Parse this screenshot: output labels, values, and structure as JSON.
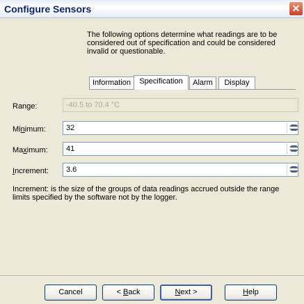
{
  "window": {
    "title": "Configure Sensors",
    "close_glyph": "✕"
  },
  "intro_text": "The following options determine what readings are to be considered out of specification and could be considered invalid or questionable.",
  "tabs": [
    {
      "label": "Information",
      "active": false
    },
    {
      "label": "Specification",
      "active": true
    },
    {
      "label": "Alarm",
      "active": false
    },
    {
      "label": "Display",
      "active": false
    }
  ],
  "fields": {
    "range": {
      "label": "Range:",
      "value": "-40.5 to 70.4 °C"
    },
    "minimum": {
      "label_pre": "Mi",
      "label_u": "n",
      "label_post": "imum:",
      "value": "32"
    },
    "maximum": {
      "label_pre": "Ma",
      "label_u": "x",
      "label_post": "imum:",
      "value": "41"
    },
    "increment": {
      "label_pre": "",
      "label_u": "I",
      "label_post": "ncrement:",
      "value": "3.6"
    }
  },
  "note": "Increment: is the size of the groups of data readings accrued outside the range limits specified by the software not by the logger.",
  "buttons": {
    "cancel": "Cancel",
    "back_pre": "< ",
    "back_u": "B",
    "back_post": "ack",
    "next_u": "N",
    "next_post": "ext >",
    "help_u": "H",
    "help_post": "elp"
  }
}
